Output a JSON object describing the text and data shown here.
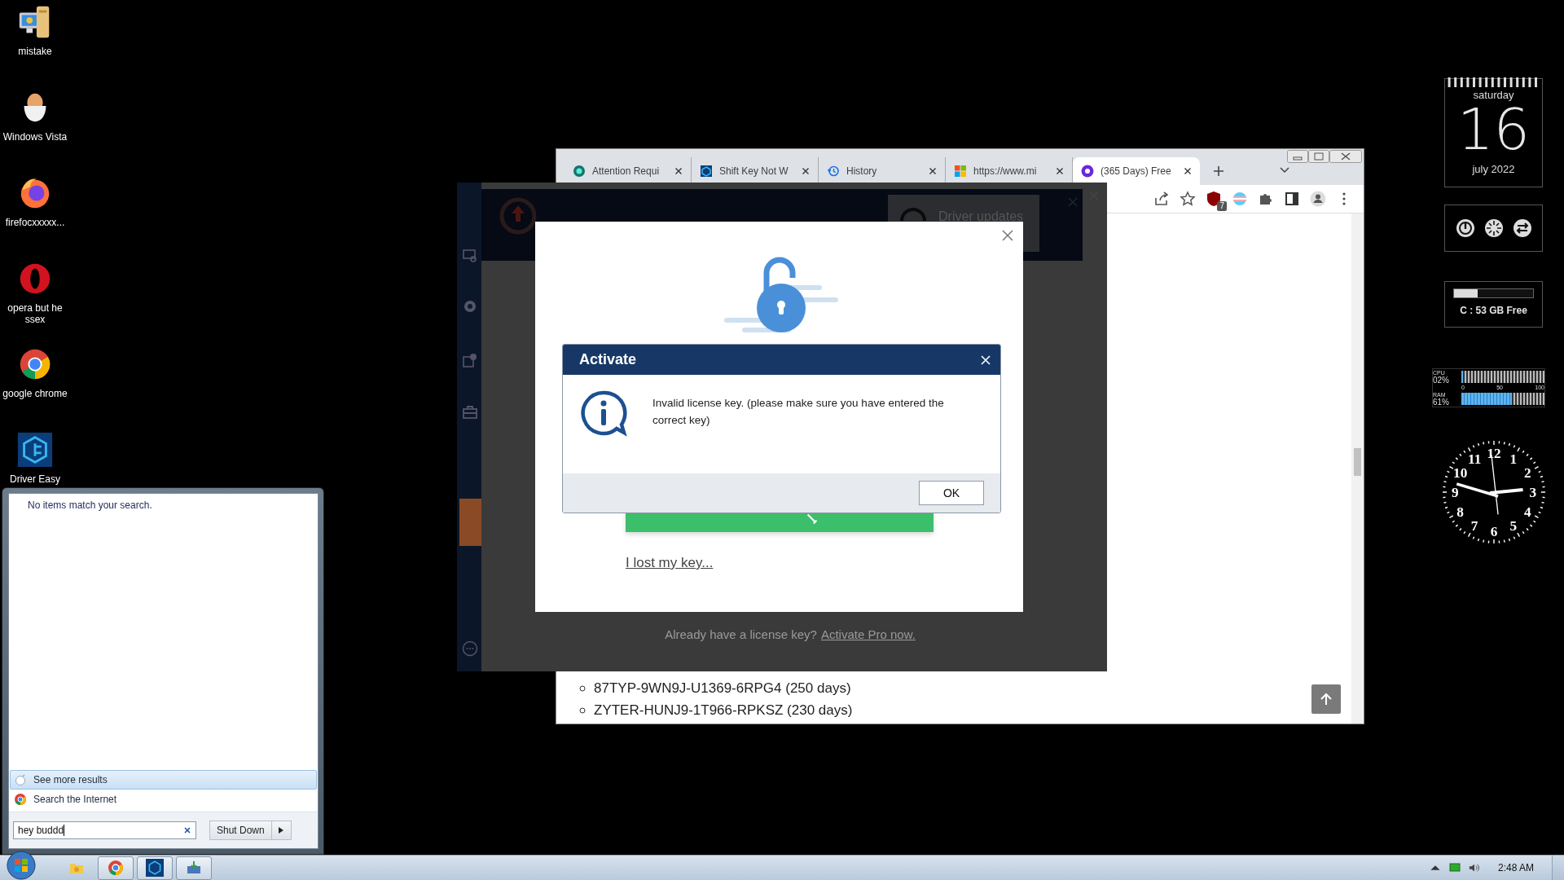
{
  "desktop_icons": [
    {
      "kind": "computer",
      "label": "mistake"
    },
    {
      "kind": "egg",
      "label": "Windows Vista"
    },
    {
      "kind": "firefox",
      "label": "firefocxxxxx..."
    },
    {
      "kind": "opera",
      "label": "opera but he ssex"
    },
    {
      "kind": "chrome",
      "label": "google chrome"
    },
    {
      "kind": "drivereasy",
      "label": "Driver Easy"
    }
  ],
  "browser": {
    "tabs": [
      {
        "kind": "green",
        "title": "Attention Requi",
        "selected": false
      },
      {
        "kind": "drivereasy",
        "title": "Shift Key Not W",
        "selected": false
      },
      {
        "kind": "history",
        "title": "History",
        "selected": false
      },
      {
        "kind": "windows",
        "title": "https://www.mi",
        "selected": false
      },
      {
        "kind": "te",
        "title": "(365 Days) Free",
        "selected": true
      }
    ],
    "extension_badge": "7",
    "content": {
      "list": [
        "87TYP-9WN9J-U1369-6RPG4 (250 days)",
        "ZYTER-HUNJ9-1T966-RPKSZ (230 days)"
      ]
    }
  },
  "app": {
    "header_card": "Driver updates",
    "footer_text": "Already have a license key?",
    "footer_link": "Activate Pro now.",
    "activation_panel": {
      "link": "I lost my key..."
    }
  },
  "dialog": {
    "title": "Activate",
    "message": "Invalid license key. (please make sure you have entered the correct key)",
    "ok_button": "OK"
  },
  "start_menu": {
    "no_results": "No items match your search.",
    "links": [
      {
        "kind": "more",
        "label": "See more results",
        "selected": true
      },
      {
        "kind": "web",
        "label": "Search the Internet",
        "selected": false
      }
    ],
    "search": {
      "value": "hey buddd"
    },
    "shutdown_button": "Shut Down"
  },
  "taskbar": {
    "apps": [
      {
        "kind": "folder",
        "running": false
      },
      {
        "kind": "chrome",
        "running": true
      },
      {
        "kind": "drivereasy",
        "running": true
      },
      {
        "kind": "installer",
        "running": true
      }
    ],
    "time": "2:48 AM"
  },
  "gadgets": {
    "calendar": {
      "weekday": "saturday",
      "day": "16",
      "month": "july 2022"
    },
    "disk": {
      "level": 0.3,
      "label": "C : 53 GB Free"
    },
    "meter": {
      "rows": [
        {
          "name": "CPU",
          "reading": "02%",
          "level": 0.02
        },
        {
          "name": "RAM",
          "reading": "61%",
          "level": 0.61
        }
      ],
      "scale": [
        "0",
        "50",
        "100"
      ]
    },
    "clock": {
      "numerals": [
        "12",
        "11",
        "1",
        "10",
        "2",
        "9",
        "3",
        "8",
        "4",
        "7",
        "5",
        "6"
      ]
    }
  }
}
